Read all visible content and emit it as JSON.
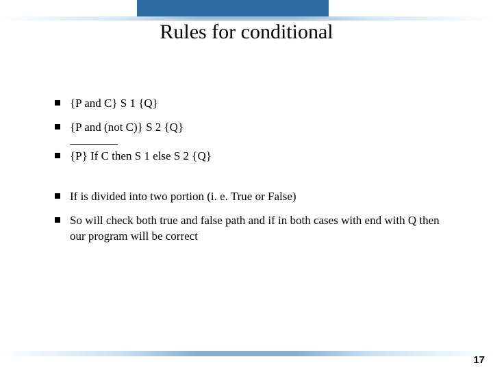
{
  "title": "Rules for conditional",
  "bullets_top": [
    "{P and  C} S 1 {Q}",
    "{P and  (not C)} S 2  {Q}",
    "{P} If C then S 1 else S 2 {Q}"
  ],
  "bullets_bottom": [
    "If is divided into two portion (i. e. True or False)",
    "So will check both true and false path and if in both cases with end with Q then our program will be correct"
  ],
  "page_number": "17"
}
